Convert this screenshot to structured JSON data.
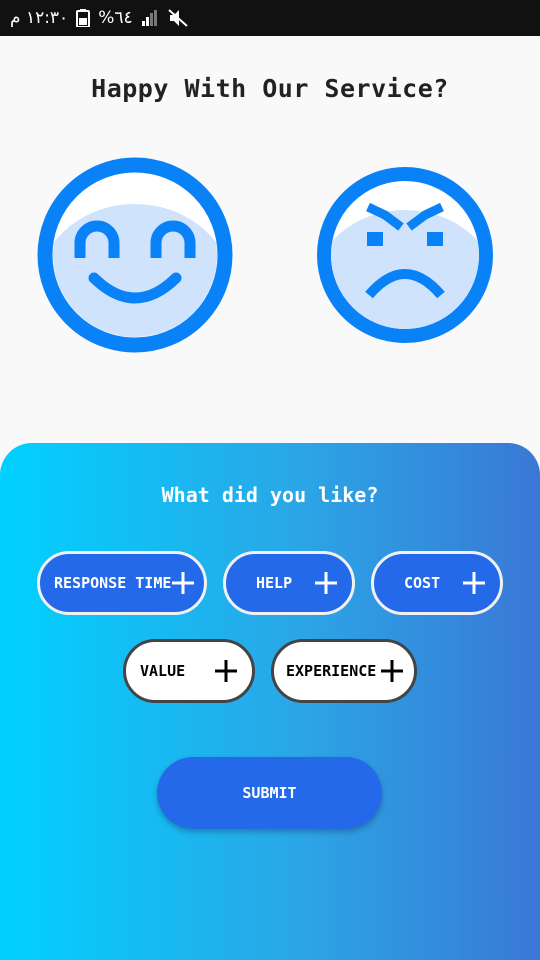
{
  "status_bar": {
    "time": "١٢:٣٠ م",
    "battery": "%٦٤"
  },
  "heading": "Happy With Our Service?",
  "faces": [
    {
      "name": "happy-face-icon"
    },
    {
      "name": "angry-face-icon"
    }
  ],
  "panel": {
    "title": "What did you like?",
    "chips": [
      {
        "label": "RESPONSE TIME",
        "selected": true
      },
      {
        "label": "HELP",
        "selected": true
      },
      {
        "label": "COST",
        "selected": true
      },
      {
        "label": "VALUE",
        "selected": false
      },
      {
        "label": "EXPERIENCE",
        "selected": false
      }
    ],
    "submit_label": "SUBMIT"
  },
  "colors": {
    "accent": "#2469ea",
    "face_blue": "#0a82f7",
    "face_fill": "#cfe3fc",
    "gradient_start": "#00d1ff",
    "gradient_end": "#3a78d6"
  }
}
